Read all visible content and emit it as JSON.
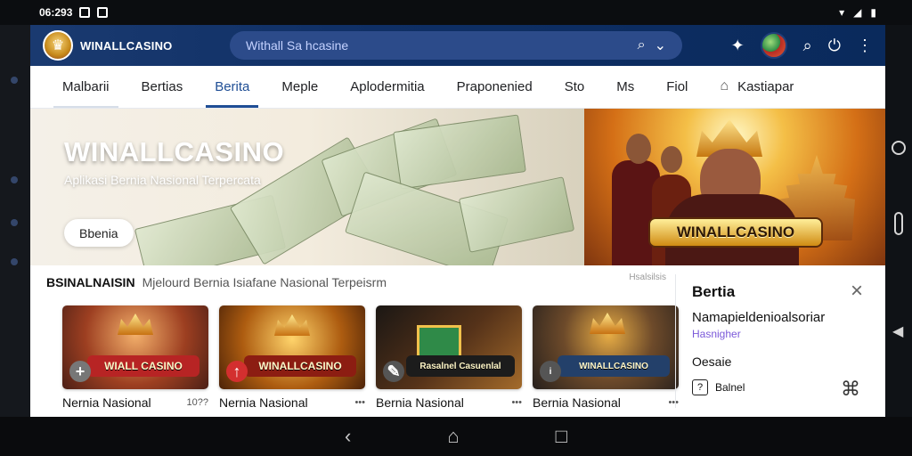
{
  "status": {
    "time": "06:293",
    "left_icons": [
      "P",
      "B"
    ],
    "right_icons": [
      "wifi-icon",
      "signal-icon",
      "battery-icon"
    ]
  },
  "app": {
    "brand": "WINALLCASINO",
    "search_placeholder": "Withall Sa hcasine",
    "actions": [
      "puzzle-icon",
      "user-avatar",
      "search-icon",
      "power-icon",
      "more-icon"
    ]
  },
  "tabs": [
    {
      "label": "Malbarii",
      "active": false
    },
    {
      "label": "Bertias",
      "active": false
    },
    {
      "label": "Berita",
      "active": true
    },
    {
      "label": "Meple",
      "active": false
    },
    {
      "label": "Aplodermitia",
      "active": false
    },
    {
      "label": "Praponenied",
      "active": false
    },
    {
      "label": "Sto",
      "active": false
    },
    {
      "label": "Ms",
      "active": false
    },
    {
      "label": "Fiol",
      "active": false
    },
    {
      "label": "Kastiapar",
      "active": false
    }
  ],
  "hero": {
    "title": "WINALLCASINO",
    "subtitle": "Aplikasi Bernia Nasional Terpercata",
    "button": "Bbenia",
    "right_label": "WINALLCASINO"
  },
  "section": {
    "title_bold": "BSINALNAISIN",
    "title_rest": "Mjelourd Bernia Isiafane Nasional Terpeisrm",
    "more": "Hsalsilsis"
  },
  "cards": [
    {
      "caption": "Nernia Nasional",
      "meta": "10??",
      "label": "WIALL CASINO"
    },
    {
      "caption": "Nernia Nasional",
      "meta": "•••",
      "label": "WINALLCASINO"
    },
    {
      "caption": "Bernia Nasional",
      "meta": "•••",
      "label": "Rasalnel Casuenlal"
    },
    {
      "caption": "Bernia Nasional",
      "meta": "•••",
      "label": "WINALLCASINO"
    }
  ],
  "panel": {
    "title": "Bertia",
    "text": "Namapieldenioalsoriar",
    "link": "Hasnigher",
    "label": "Oesaie",
    "row": "Balnel"
  },
  "colors": {
    "brand_blue": "#0f2f65",
    "active_tab": "#1f4e95",
    "gold": "#d08b13"
  }
}
